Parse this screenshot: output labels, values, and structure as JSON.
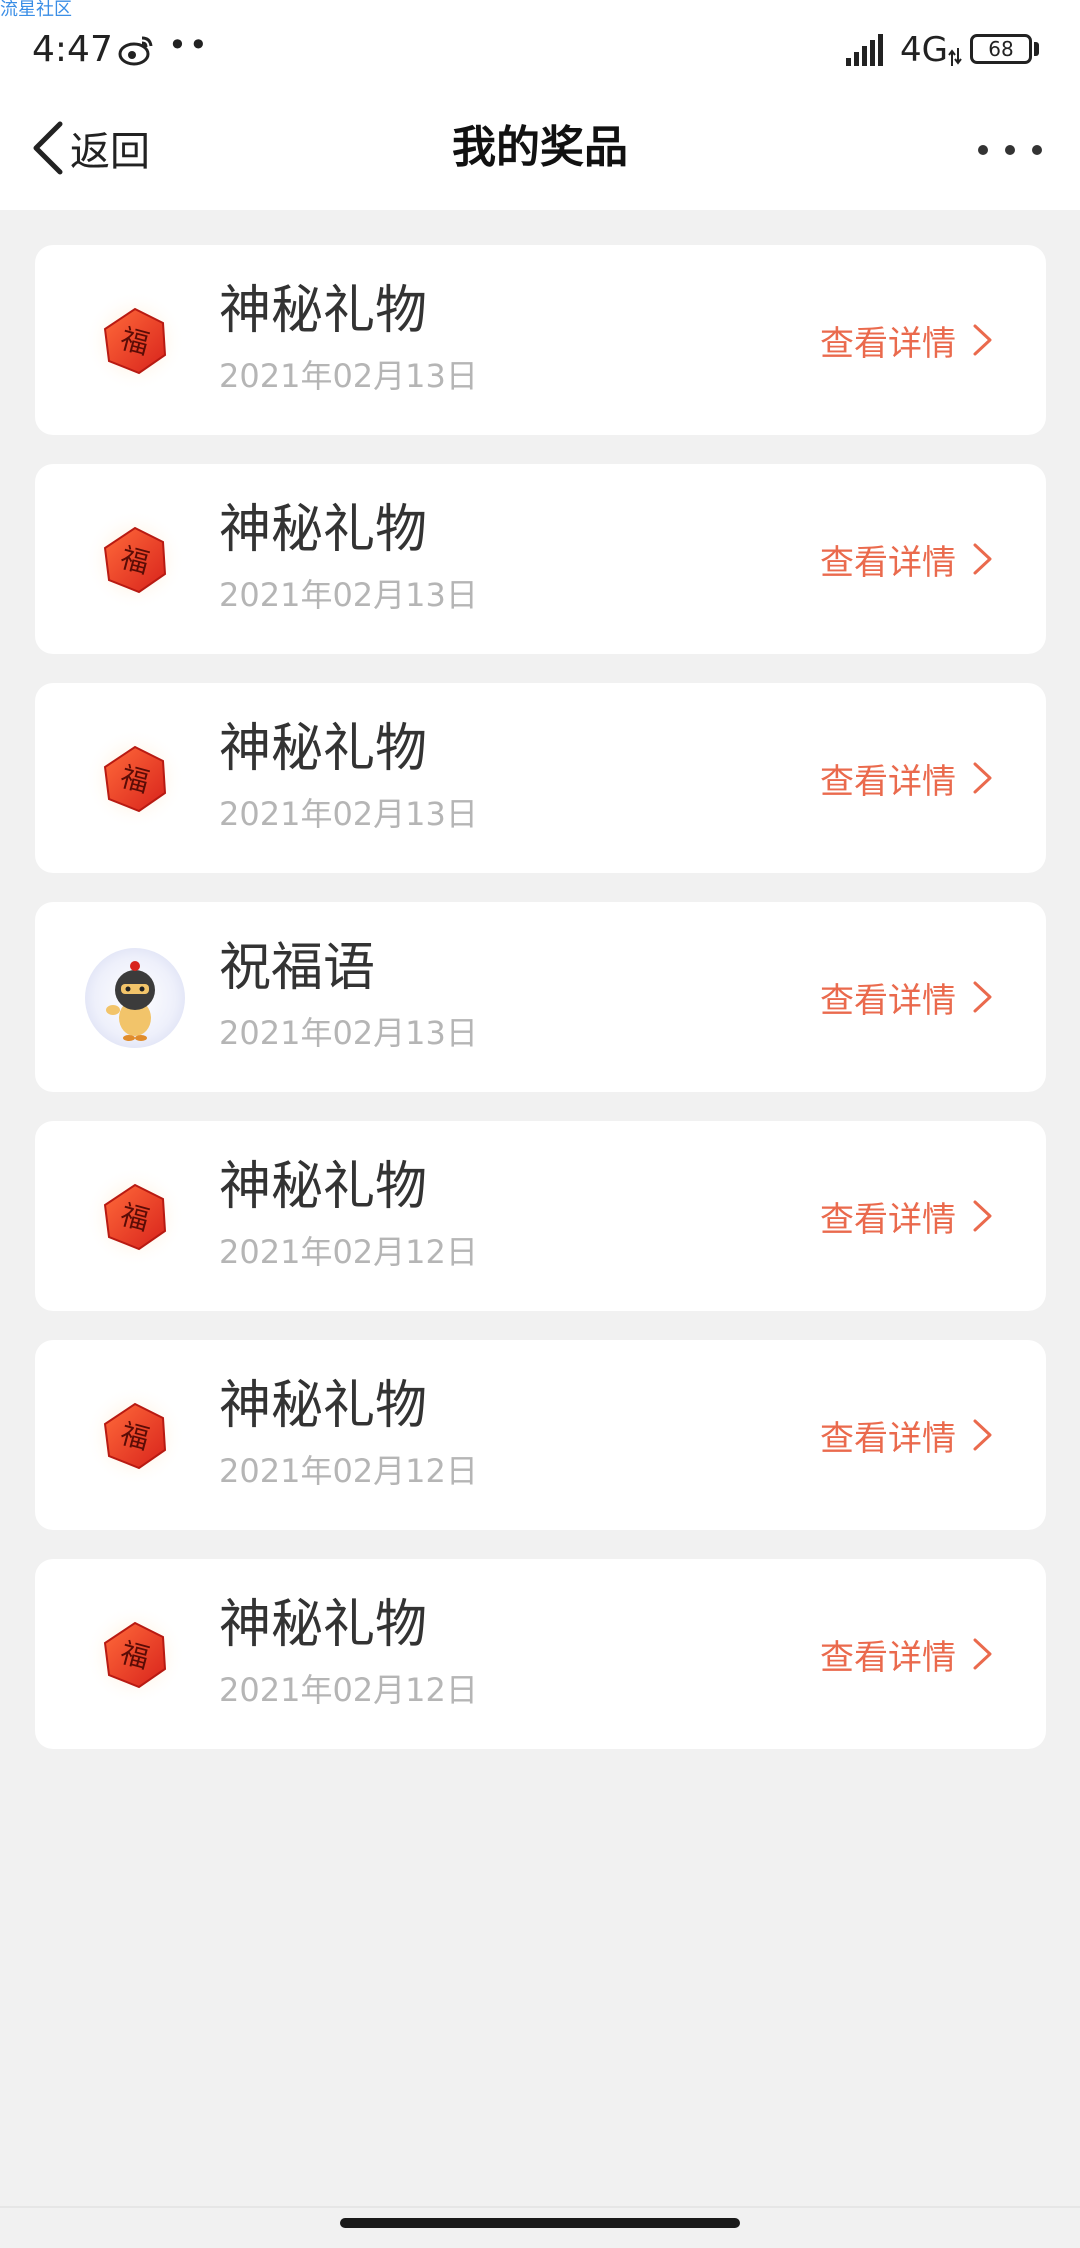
{
  "watermark": "流星社区",
  "status_bar": {
    "time": "4:47",
    "dots": "••",
    "network": "4G",
    "battery": "68",
    "icons": [
      "weibo-icon",
      "signal-icon",
      "battery-icon"
    ]
  },
  "header": {
    "back_label": "返回",
    "title": "我的奖品",
    "icons": [
      "chevron-left-icon",
      "more-dots-icon"
    ]
  },
  "colors": {
    "accent": "#ea6a4d",
    "background": "#f1f1f1",
    "card": "#ffffff",
    "date_text": "#b5b5b5"
  },
  "prizes": [
    {
      "name": "神秘礼物",
      "date": "2021年02月13日",
      "action": "查看详情",
      "icon": "fu-hexagon-icon"
    },
    {
      "name": "神秘礼物",
      "date": "2021年02月13日",
      "action": "查看详情",
      "icon": "fu-hexagon-icon"
    },
    {
      "name": "神秘礼物",
      "date": "2021年02月13日",
      "action": "查看详情",
      "icon": "fu-hexagon-icon"
    },
    {
      "name": "祝福语",
      "date": "2021年02月13日",
      "action": "查看详情",
      "icon": "mascot-avatar-icon"
    },
    {
      "name": "神秘礼物",
      "date": "2021年02月12日",
      "action": "查看详情",
      "icon": "fu-hexagon-icon"
    },
    {
      "name": "神秘礼物",
      "date": "2021年02月12日",
      "action": "查看详情",
      "icon": "fu-hexagon-icon"
    },
    {
      "name": "神秘礼物",
      "date": "2021年02月12日",
      "action": "查看详情",
      "icon": "fu-hexagon-icon"
    }
  ]
}
